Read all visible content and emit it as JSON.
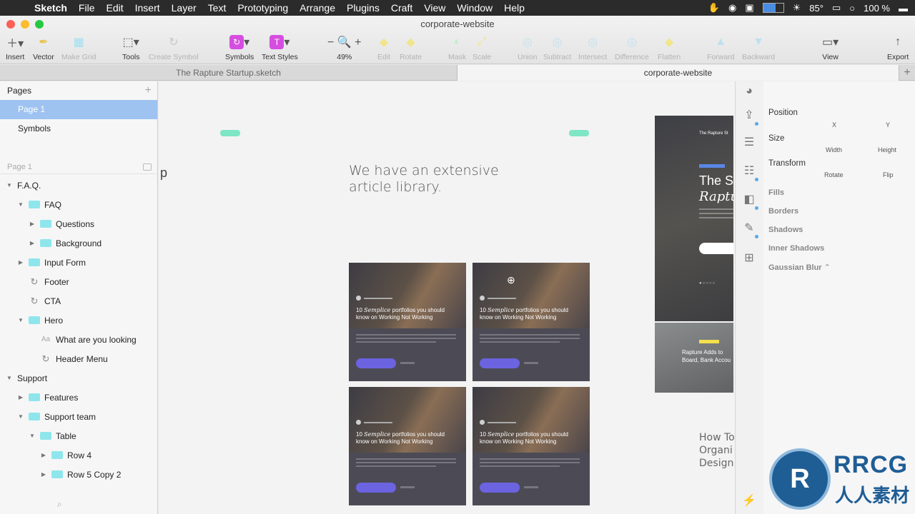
{
  "menubar": {
    "app": "Sketch",
    "items": [
      "File",
      "Edit",
      "Insert",
      "Layer",
      "Text",
      "Prototyping",
      "Arrange",
      "Plugins",
      "Craft",
      "View",
      "Window",
      "Help"
    ],
    "temperature": "85°",
    "battery": "100 %"
  },
  "window": {
    "title": "corporate-website"
  },
  "toolbar": {
    "insert": "Insert",
    "vector": "Vector",
    "make_grid": "Make Grid",
    "tools": "Tools",
    "create_symbol": "Create Symbol",
    "symbols": "Symbols",
    "text_styles": "Text Styles",
    "zoom": "49%",
    "edit": "Edit",
    "rotate": "Rotate",
    "mask": "Mask",
    "scale": "Scale",
    "union": "Union",
    "subtract": "Subtract",
    "intersect": "Intersect",
    "difference": "Difference",
    "flatten": "Flatten",
    "forward": "Forward",
    "backward": "Backward",
    "view": "View",
    "export": "Export"
  },
  "tabs": [
    "The Rapture Startup.sketch",
    "corporate-website"
  ],
  "sidebar": {
    "pages_title": "Pages",
    "pages": [
      "Page 1",
      "Symbols"
    ],
    "filter_label": "Page 1",
    "layers": [
      {
        "label": "F.A.Q.",
        "depth": 0,
        "kind": "none",
        "expanded": true
      },
      {
        "label": "FAQ",
        "depth": 1,
        "kind": "folder",
        "expanded": true
      },
      {
        "label": "Questions",
        "depth": 2,
        "kind": "folder",
        "expanded": false
      },
      {
        "label": "Background",
        "depth": 2,
        "kind": "folder",
        "expanded": false
      },
      {
        "label": "Input Form",
        "depth": 1,
        "kind": "folder",
        "expanded": false
      },
      {
        "label": "Footer",
        "depth": 1,
        "kind": "symbol",
        "expanded": null
      },
      {
        "label": "CTA",
        "depth": 1,
        "kind": "symbol",
        "expanded": null
      },
      {
        "label": "Hero",
        "depth": 1,
        "kind": "folder",
        "expanded": true
      },
      {
        "label": "What are you looking",
        "depth": 2,
        "kind": "text",
        "expanded": null
      },
      {
        "label": "Header Menu",
        "depth": 2,
        "kind": "symbol",
        "expanded": null
      },
      {
        "label": "Support",
        "depth": 0,
        "kind": "none",
        "expanded": true
      },
      {
        "label": "Features",
        "depth": 1,
        "kind": "folder",
        "expanded": false
      },
      {
        "label": "Support team",
        "depth": 1,
        "kind": "folder",
        "expanded": true
      },
      {
        "label": "Table",
        "depth": 2,
        "kind": "folder",
        "expanded": true
      },
      {
        "label": "Row 4",
        "depth": 3,
        "kind": "folder",
        "expanded": false
      },
      {
        "label": "Row 5 Copy 2",
        "depth": 3,
        "kind": "folder",
        "expanded": false
      }
    ]
  },
  "canvas": {
    "headline_line1": "We have an extensive",
    "headline_line2": "article library.",
    "edge_letter": "p",
    "card_title_italic": "Semplice",
    "card_title_pre": "10 ",
    "card_title_post": " portfolios you should know on Working Not Working",
    "right_small": "The Rapture St",
    "right_big1": "The S",
    "right_big2": "Raptu",
    "right_caption": "Rapture Adds to Board, Bank Accou",
    "howto_1": "How To",
    "howto_2": "Organi",
    "howto_3": "Design"
  },
  "inspector": {
    "position": "Position",
    "x": "X",
    "y": "Y",
    "size": "Size",
    "width": "Width",
    "height": "Height",
    "transform": "Transform",
    "rotate": "Rotate",
    "flip": "Flip",
    "fills": "Fills",
    "borders": "Borders",
    "shadows": "Shadows",
    "inner_shadows": "Inner Shadows",
    "gaussian_blur": "Gaussian Blur"
  },
  "watermark": {
    "brand": "RRCG",
    "sub": "人人素材"
  },
  "colors": {
    "selection": "#9ec3f1",
    "folder": "#8ee6ec",
    "accent_button": "#6b63e0",
    "symbol_badge": "#d64ee0"
  }
}
